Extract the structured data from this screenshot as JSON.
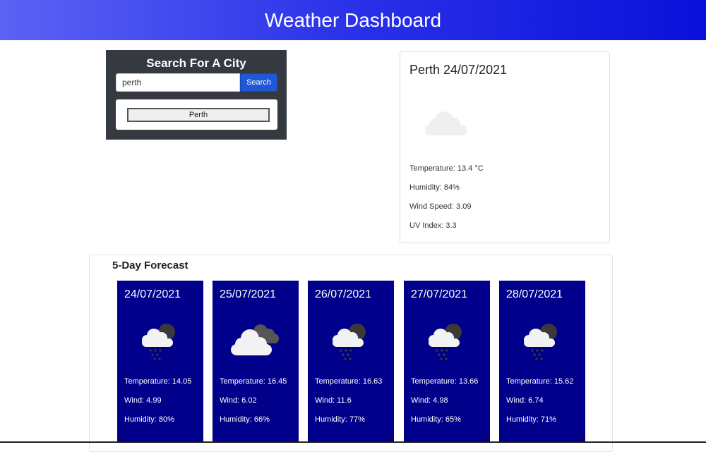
{
  "header": {
    "title": "Weather Dashboard"
  },
  "search": {
    "title": "Search For A City",
    "input_value": "perth",
    "button_label": "Search",
    "history": [
      "Perth"
    ]
  },
  "current": {
    "city_date": "Perth 24/07/2021",
    "icon": "cloud-icon",
    "temperature": "Temperature: 13.4 °C",
    "humidity": "Humidity: 84%",
    "wind": "Wind Speed: 3.09",
    "uv": "UV Index: 3.3"
  },
  "forecast": {
    "heading": "5-Day Forecast",
    "days": [
      {
        "date": "24/07/2021",
        "icon": "night-rain-icon",
        "temperature": "Temperature: 14.05",
        "wind": "Wind: 4.99",
        "humidity": "Humidity: 80%"
      },
      {
        "date": "25/07/2021",
        "icon": "broken-clouds-icon",
        "temperature": "Temperature: 16.45",
        "wind": "Wind: 6.02",
        "humidity": "Humidity: 66%"
      },
      {
        "date": "26/07/2021",
        "icon": "night-rain-icon",
        "temperature": "Temperature: 16.63",
        "wind": "Wind: 11.6",
        "humidity": "Humidity: 77%"
      },
      {
        "date": "27/07/2021",
        "icon": "night-rain-icon",
        "temperature": "Temperature: 13.66",
        "wind": "Wind: 4.98",
        "humidity": "Humidity: 65%"
      },
      {
        "date": "28/07/2021",
        "icon": "night-rain-icon",
        "temperature": "Temperature: 15.62",
        "wind": "Wind: 6.74",
        "humidity": "Humidity: 71%"
      }
    ]
  },
  "colors": {
    "header_start": "#5b63f5",
    "header_end": "#0a10d9",
    "card_bg": "#00008b",
    "search_panel": "#343a40",
    "search_button": "#2057d6"
  }
}
